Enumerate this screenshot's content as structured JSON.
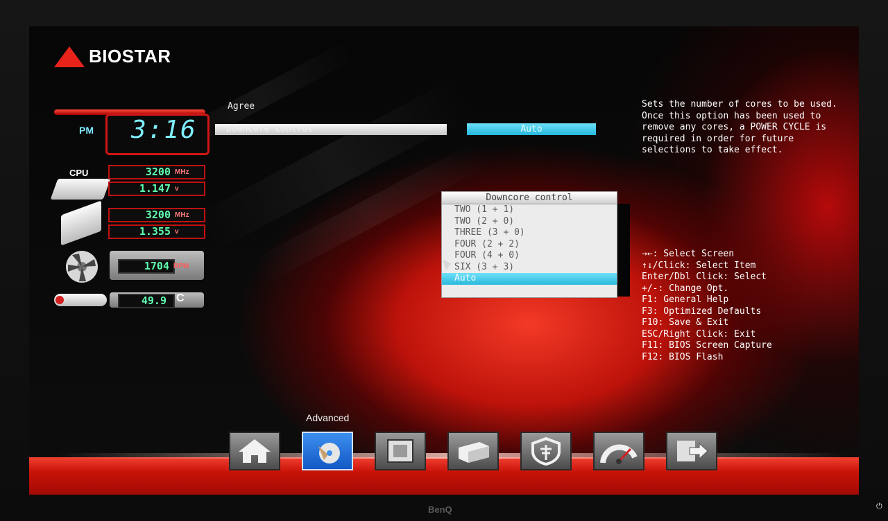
{
  "brand": {
    "logo_text": "BIOSTAR"
  },
  "monitor": {
    "brand": "BenQ",
    "power_icon": "power-icon"
  },
  "status_panel": {
    "time_meridiem": "PM",
    "time": "3:16",
    "cpu_label": "CPU",
    "cpu_freq": "3200",
    "cpu_freq_unit": "MHz",
    "cpu_volt": "1.147",
    "cpu_volt_unit": "v",
    "mem_freq": "3200",
    "mem_freq_unit": "MHz",
    "mem_volt": "1.355",
    "mem_volt_unit": "v",
    "fan_rpm": "1704",
    "fan_unit": "RPM",
    "temp": "49.9",
    "temp_unit": "C"
  },
  "setup": {
    "section_label": "Agree",
    "option_label": "Downcore control",
    "option_value": "Auto"
  },
  "help_text": "Sets the number of cores to be used. Once this option has been used to remove any cores, a POWER CYCLE is required in order for future selections to take effect.",
  "keys": [
    "→←: Select Screen",
    "↑↓/Click: Select Item",
    "Enter/Dbl Click: Select",
    "+/-: Change Opt.",
    "F1: General Help",
    "F3: Optimized Defaults",
    "F10: Save & Exit",
    "ESC/Right Click: Exit",
    "F11: BIOS Screen Capture",
    "F12: BIOS Flash"
  ],
  "popup": {
    "title": "Downcore control",
    "options": [
      "TWO (1 + 1)",
      "TWO (2 + 0)",
      "THREE (3 + 0)",
      "FOUR (2 + 2)",
      "FOUR (4 + 0)",
      "SIX (3 + 3)",
      "Auto"
    ],
    "selected_index": 6
  },
  "nav": {
    "active_caption": "Advanced",
    "buttons": [
      "home-icon",
      "advanced-icon",
      "chipset-icon",
      "boot-icon",
      "security-icon",
      "oc-gauge-icon",
      "exit-icon"
    ],
    "active_index": 1
  }
}
